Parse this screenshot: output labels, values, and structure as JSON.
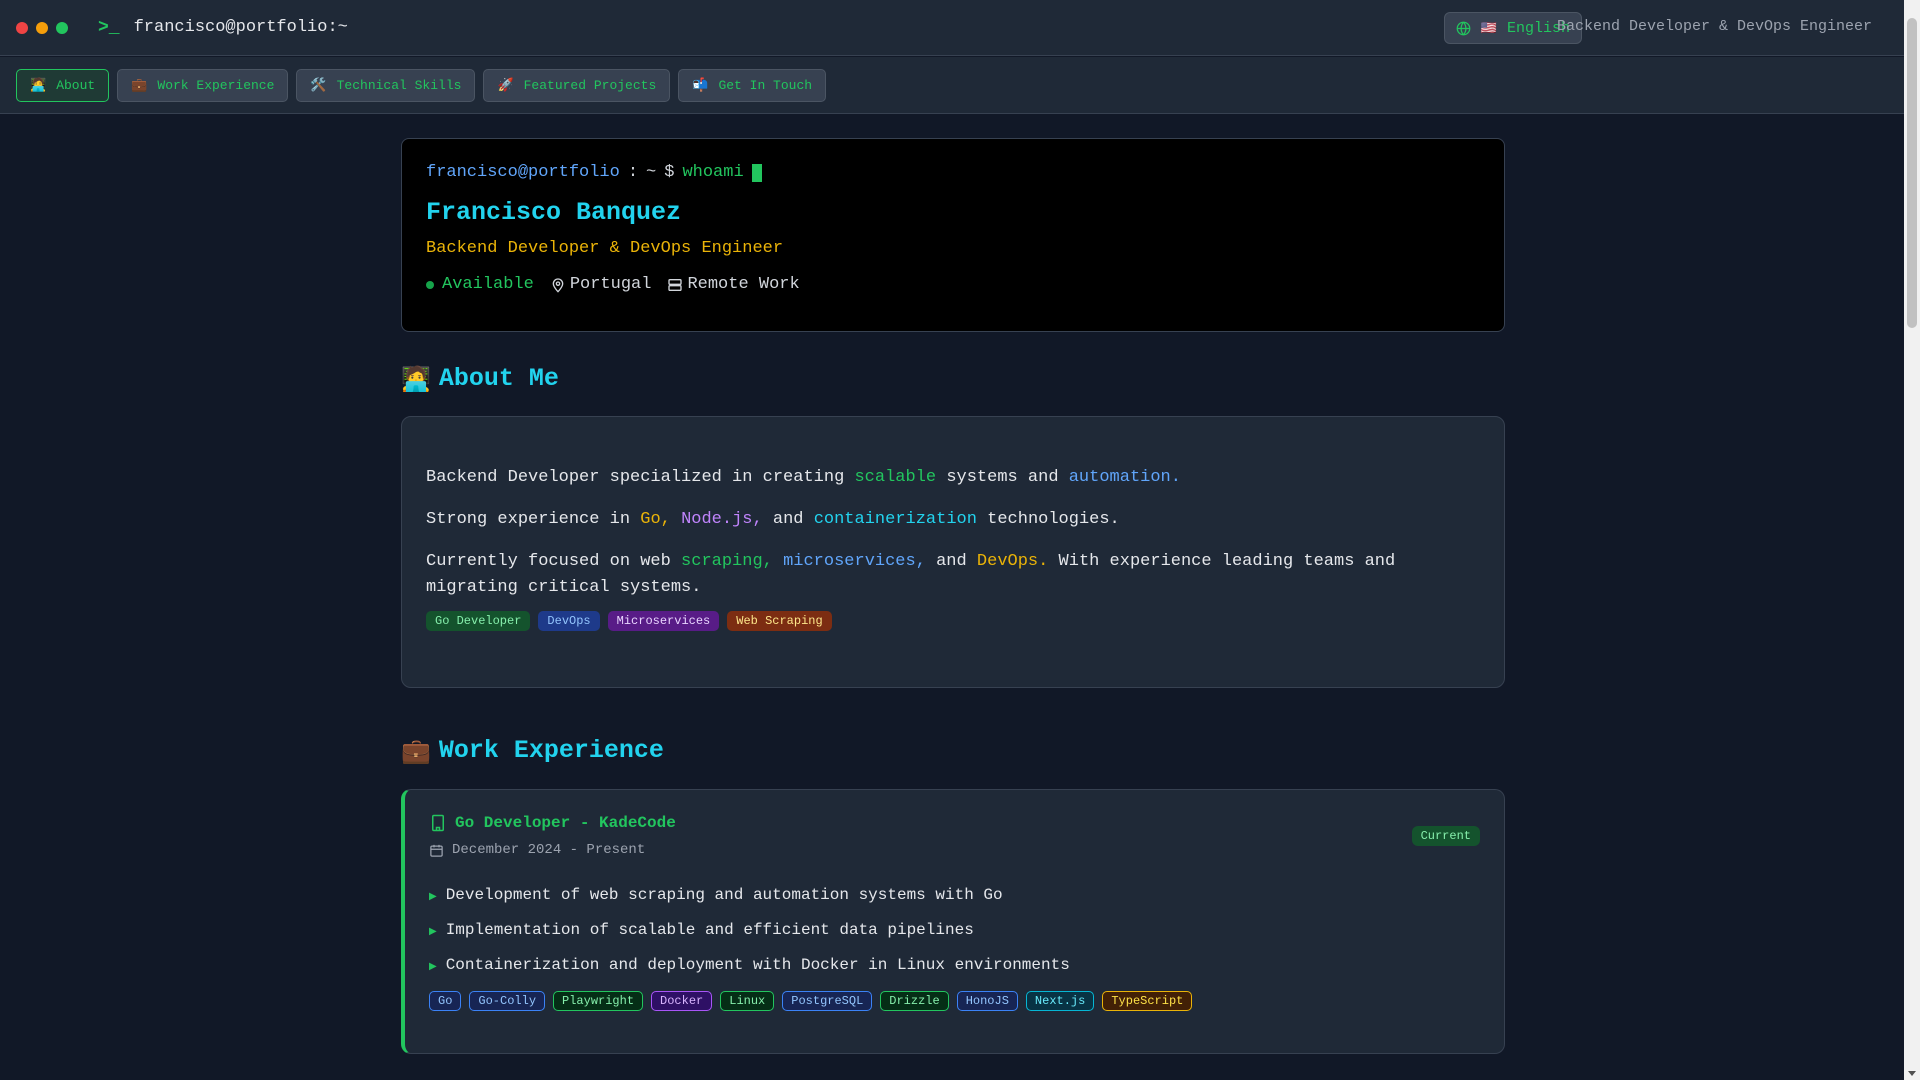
{
  "titlebar": {
    "title": "francisco@portfolio:~",
    "language": "English",
    "language_flag": "🇺🇸",
    "role": "Backend Developer & DevOps Engineer"
  },
  "nav": {
    "items": [
      {
        "emoji": "🧑‍💻",
        "label": "About"
      },
      {
        "emoji": "💼",
        "label": "Work Experience"
      },
      {
        "emoji": "🛠️",
        "label": "Technical Skills"
      },
      {
        "emoji": "🚀",
        "label": "Featured Projects"
      },
      {
        "emoji": "📬",
        "label": "Get In Touch"
      }
    ]
  },
  "terminal": {
    "user": "francisco@portfolio",
    "sep": ":",
    "path": "~",
    "dollar": "$",
    "command": "whoami",
    "name": "Francisco Banquez",
    "role": "Backend Developer & DevOps Engineer",
    "status": "Available",
    "location": "Portugal",
    "work_mode": "Remote Work"
  },
  "about": {
    "emoji": "🧑‍💻",
    "title": "About Me",
    "p1": {
      "a": "Backend Developer specialized in creating",
      "b": "scalable",
      "c": "systems and",
      "d": "automation."
    },
    "p2": {
      "a": "Strong experience in",
      "b": "Go,",
      "c": "Node.js,",
      "d": "and",
      "e": "containerization",
      "f": "technologies."
    },
    "p3": {
      "a": "Currently focused on web",
      "b": "scraping,",
      "c": "microservices,",
      "d": "and",
      "e": "DevOps.",
      "f": "With experience leading teams and migrating critical systems."
    },
    "tags": [
      "Go Developer",
      "DevOps",
      "Microservices",
      "Web Scraping"
    ]
  },
  "work": {
    "emoji": "💼",
    "title": "Work Experience",
    "job": {
      "title": "Go Developer - KadeCode",
      "dates": "December 2024 - Present",
      "badge": "Current",
      "bullets": [
        "Development of web scraping and automation systems with Go",
        "Implementation of scalable and efficient data pipelines",
        "Containerization and deployment with Docker in Linux environments"
      ],
      "tech": [
        "Go",
        "Go-Colly",
        "Playwright",
        "Docker",
        "Linux",
        "PostgreSQL",
        "Drizzle",
        "HonoJS",
        "Next.js",
        "TypeScript"
      ]
    }
  },
  "colors": {
    "accent_green": "#22c55e",
    "accent_cyan": "#22d3ee",
    "accent_yellow": "#eab308",
    "background": "#111827"
  }
}
